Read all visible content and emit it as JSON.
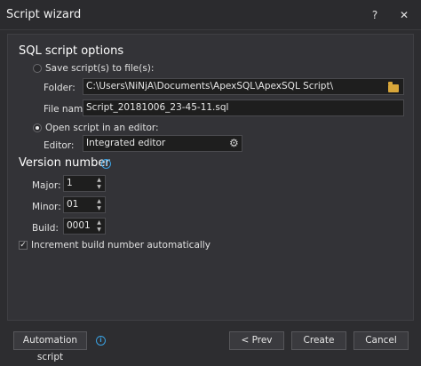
{
  "window": {
    "title": "Script wizard",
    "help_label": "?",
    "close_label": "✕"
  },
  "sql_options": {
    "heading": "SQL script options",
    "save_to_file_label": "Save script(s) to file(s):",
    "folder_label": "Folder:",
    "folder_value": "C:\\Users\\NiNjA\\Documents\\ApexSQL\\ApexSQL Script\\",
    "filename_label": "File name:",
    "filename_value": "Script_20181006_23-45-11.sql",
    "open_editor_label": "Open script in an editor:",
    "editor_label": "Editor:",
    "editor_value": "Integrated editor"
  },
  "version": {
    "heading": "Version number",
    "major_label": "Major:",
    "major_value": "1",
    "minor_label": "Minor:",
    "minor_value": "01",
    "build_label": "Build:",
    "build_value": "0001",
    "increment_label": "Increment build number automatically"
  },
  "footer": {
    "automation_label": "Automation script",
    "prev_label": "< Prev",
    "create_label": "Create",
    "cancel_label": "Cancel"
  },
  "colors": {
    "background": "#2d2d30",
    "panel": "#333337",
    "info_accent": "#3aa0e0",
    "folder": "#d8a63a"
  }
}
